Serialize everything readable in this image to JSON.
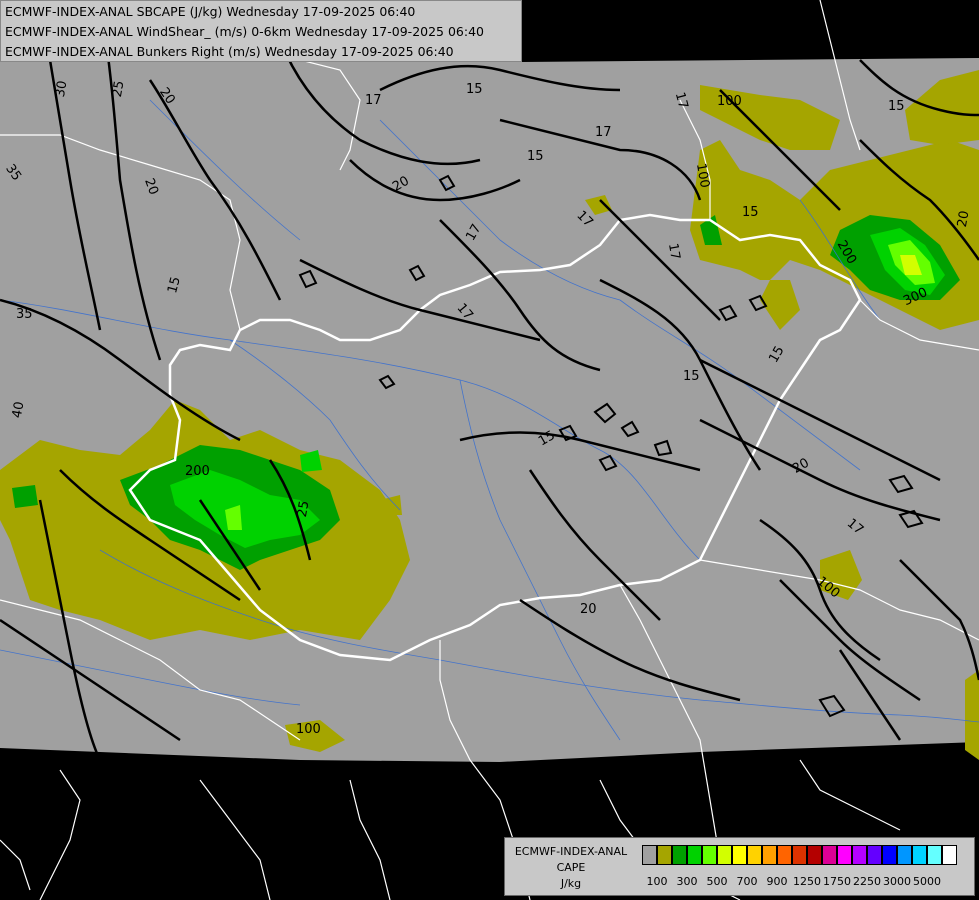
{
  "header": {
    "line1": "ECMWF-INDEX-ANAL SBCAPE (J/kg) Wednesday 17-09-2025 06:40",
    "line2": "ECMWF-INDEX-ANAL WindShear_ (m/s) 0-6km Wednesday 17-09-2025 06:40",
    "line3": "ECMWF-INDEX-ANAL Bunkers Right (m/s) Wednesday 17-09-2025 06:40"
  },
  "legend": {
    "line1": "ECMWF-INDEX-ANAL",
    "line2": "CAPE",
    "line3": "J/kg",
    "colors": [
      "#a0a0a0",
      "#a5a500",
      "#00a000",
      "#00d200",
      "#64ff00",
      "#d2ff00",
      "#ffff00",
      "#ffd200",
      "#ffa000",
      "#ff6400",
      "#dc3200",
      "#b40000",
      "#dc0096",
      "#ff00ff",
      "#b400ff",
      "#6400ff",
      "#0000ff",
      "#0096ff",
      "#00d2ff",
      "#64ffff",
      "#ffffff"
    ],
    "ticks": [
      "100",
      "300",
      "500",
      "700",
      "900",
      "1250",
      "1750",
      "2250",
      "3000",
      "5000"
    ]
  },
  "map": {
    "background": "#a0a0a0",
    "outside_color": "#000000",
    "contour_labels": [
      "30",
      "25",
      "20",
      "35",
      "20",
      "35",
      "40",
      "17",
      "15",
      "17",
      "15",
      "20",
      "17",
      "17",
      "15",
      "17",
      "100",
      "15",
      "17",
      "15",
      "17",
      "15",
      "15",
      "20",
      "17",
      "15",
      "100",
      "200",
      "300",
      "20",
      "25",
      "200",
      "100",
      "100",
      "20",
      "15"
    ]
  }
}
